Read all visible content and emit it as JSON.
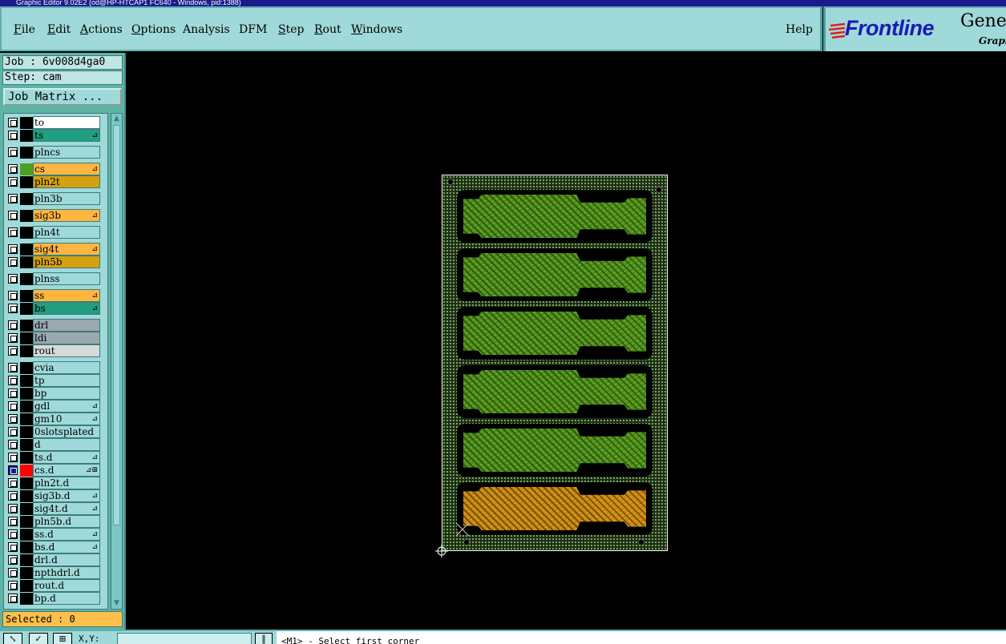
{
  "window": {
    "title": "Graphic Editor 9.02E2 (od@HP-HTCAP1 FC640 - Windows, pid:1388)"
  },
  "menubar": {
    "items": [
      "File",
      "Edit",
      "Actions",
      "Options",
      "Analysis",
      "DFM",
      "Step",
      "Rout",
      "Windows"
    ],
    "help": "Help"
  },
  "brand": {
    "name": "Frontline",
    "product": "Genesis",
    "subtitle": "Graphic"
  },
  "job": {
    "label": "Job : 6v008d4ga0",
    "step": "Step: cam",
    "matrix_button": "Job Matrix ..."
  },
  "layers": [
    {
      "name": "to",
      "bg": "#ffffff",
      "swatch": "#000000",
      "mark": ""
    },
    {
      "name": "ts",
      "bg": "#1f9f7f",
      "swatch": "#000000",
      "mark": "⊿"
    },
    {
      "name": "plncs",
      "bg": "#9fd9d9",
      "swatch": "#000000",
      "mark": ""
    },
    {
      "name": "cs",
      "bg": "#ffb640",
      "swatch": "#4f9f1f",
      "mark": "⊿"
    },
    {
      "name": "pln2t",
      "bg": "#d6a010",
      "swatch": "#000000",
      "mark": ""
    },
    {
      "name": "pln3b",
      "bg": "#9fd9d9",
      "swatch": "#000000",
      "mark": ""
    },
    {
      "name": "sig3b",
      "bg": "#ffb640",
      "swatch": "#000000",
      "mark": "⊿"
    },
    {
      "name": "pln4t",
      "bg": "#9fd9d9",
      "swatch": "#000000",
      "mark": ""
    },
    {
      "name": "sig4t",
      "bg": "#ffb640",
      "swatch": "#000000",
      "mark": "⊿"
    },
    {
      "name": "pln5b",
      "bg": "#d6a010",
      "swatch": "#000000",
      "mark": ""
    },
    {
      "name": "plnss",
      "bg": "#9fd9d9",
      "swatch": "#000000",
      "mark": ""
    },
    {
      "name": "ss",
      "bg": "#ffb640",
      "swatch": "#000000",
      "mark": "⊿"
    },
    {
      "name": "bs",
      "bg": "#1f9f7f",
      "swatch": "#000000",
      "mark": "⊿"
    },
    {
      "name": "drl",
      "bg": "#9aa8b0",
      "swatch": "#000000",
      "mark": ""
    },
    {
      "name": "ldi",
      "bg": "#9aa8b0",
      "swatch": "#000000",
      "mark": ""
    },
    {
      "name": "rout",
      "bg": "#d8d8d8",
      "swatch": "#000000",
      "mark": ""
    },
    {
      "name": "cvia",
      "bg": "#9fd9d9",
      "swatch": "#000000",
      "mark": ""
    },
    {
      "name": "tp",
      "bg": "#9fd9d9",
      "swatch": "#000000",
      "mark": ""
    },
    {
      "name": "bp",
      "bg": "#9fd9d9",
      "swatch": "#000000",
      "mark": ""
    },
    {
      "name": "gdl",
      "bg": "#9fd9d9",
      "swatch": "#000000",
      "mark": "⊿"
    },
    {
      "name": "gm10",
      "bg": "#9fd9d9",
      "swatch": "#000000",
      "mark": "⊿"
    },
    {
      "name": "0slotsplated",
      "bg": "#9fd9d9",
      "swatch": "#000000",
      "mark": ""
    },
    {
      "name": "d",
      "bg": "#9fd9d9",
      "swatch": "#000000",
      "mark": ""
    },
    {
      "name": "ts.d",
      "bg": "#9fd9d9",
      "swatch": "#000000",
      "mark": "⊿"
    },
    {
      "name": "cs.d",
      "bg": "#9fd9d9",
      "swatch": "#ff0000",
      "mark": "⊿⊞",
      "selected": true
    },
    {
      "name": "pln2t.d",
      "bg": "#9fd9d9",
      "swatch": "#000000",
      "mark": ""
    },
    {
      "name": "sig3b.d",
      "bg": "#9fd9d9",
      "swatch": "#000000",
      "mark": "⊿"
    },
    {
      "name": "sig4t.d",
      "bg": "#9fd9d9",
      "swatch": "#000000",
      "mark": "⊿"
    },
    {
      "name": "pln5b.d",
      "bg": "#9fd9d9",
      "swatch": "#000000",
      "mark": ""
    },
    {
      "name": "ss.d",
      "bg": "#9fd9d9",
      "swatch": "#000000",
      "mark": "⊿"
    },
    {
      "name": "bs.d",
      "bg": "#9fd9d9",
      "swatch": "#000000",
      "mark": "⊿"
    },
    {
      "name": "drl.d",
      "bg": "#9fd9d9",
      "swatch": "#000000",
      "mark": ""
    },
    {
      "name": "npthdrl.d",
      "bg": "#9fd9d9",
      "swatch": "#000000",
      "mark": ""
    },
    {
      "name": "rout.d",
      "bg": "#9fd9d9",
      "swatch": "#000000",
      "mark": ""
    },
    {
      "name": "bp.d",
      "bg": "#9fd9d9",
      "swatch": "#000000",
      "mark": ""
    }
  ],
  "selected": "Selected : 0",
  "status": {
    "xy_label": "X,Y:",
    "xy_value": "",
    "prompt": "<M1> - Select first corner"
  },
  "panels": [
    "green",
    "green",
    "green",
    "green",
    "green",
    "orange"
  ]
}
